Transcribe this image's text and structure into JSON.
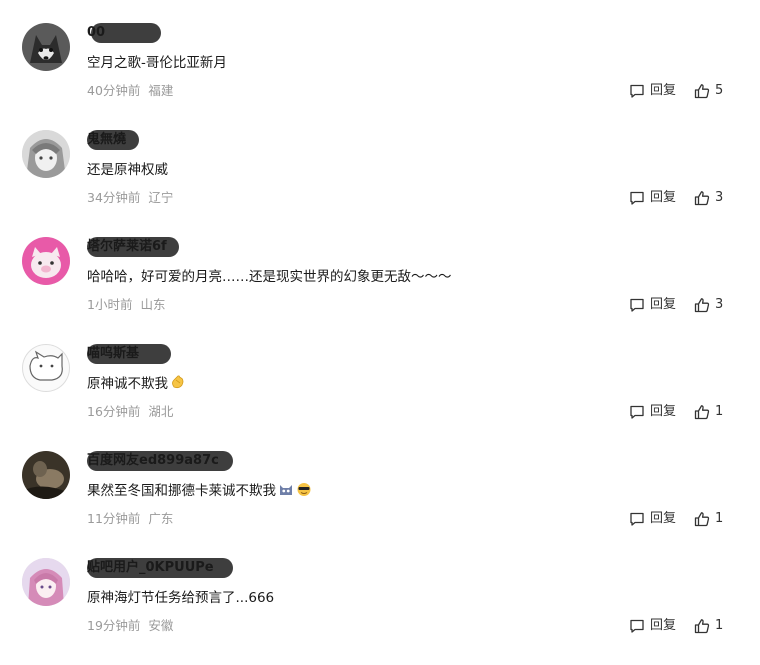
{
  "comments": [
    {
      "username": "00",
      "content": "空月之歌-哥伦比亚新月",
      "time": "40分钟前",
      "location": "福建",
      "reply_label": "回复",
      "likes": "5"
    },
    {
      "username": "鬼無燒",
      "content": "还是原神权威",
      "time": "34分钟前",
      "location": "辽宁",
      "reply_label": "回复",
      "likes": "3"
    },
    {
      "username": "塔尔萨莱诺6f",
      "content": "哈哈哈，好可爱的月亮……还是现实世界的幻象更无敌〜〜〜",
      "time": "1小时前",
      "location": "山东",
      "reply_label": "回复",
      "likes": "3"
    },
    {
      "username": "喵呜斯基",
      "content": "原神诚不欺我",
      "time": "16分钟前",
      "location": "湖北",
      "reply_label": "回复",
      "likes": "1"
    },
    {
      "username": "百度网友ed899a87c",
      "content": "果然至冬国和挪德卡莱诚不欺我",
      "time": "11分钟前",
      "location": "广东",
      "reply_label": "回复",
      "likes": "1"
    },
    {
      "username": "贴吧用户_0KPUUPe",
      "content": "原神海灯节任务给预言了...666",
      "time": "19分钟前",
      "location": "安徽",
      "reply_label": "回复",
      "likes": "1"
    }
  ],
  "icons": {
    "reply": "comment-bubble-icon",
    "like": "thumbs-up-icon",
    "emoji_clap": "clapping-hands-emoji",
    "emoji_cat": "cat-face-emoji",
    "emoji_cool": "sunglasses-face-emoji"
  }
}
